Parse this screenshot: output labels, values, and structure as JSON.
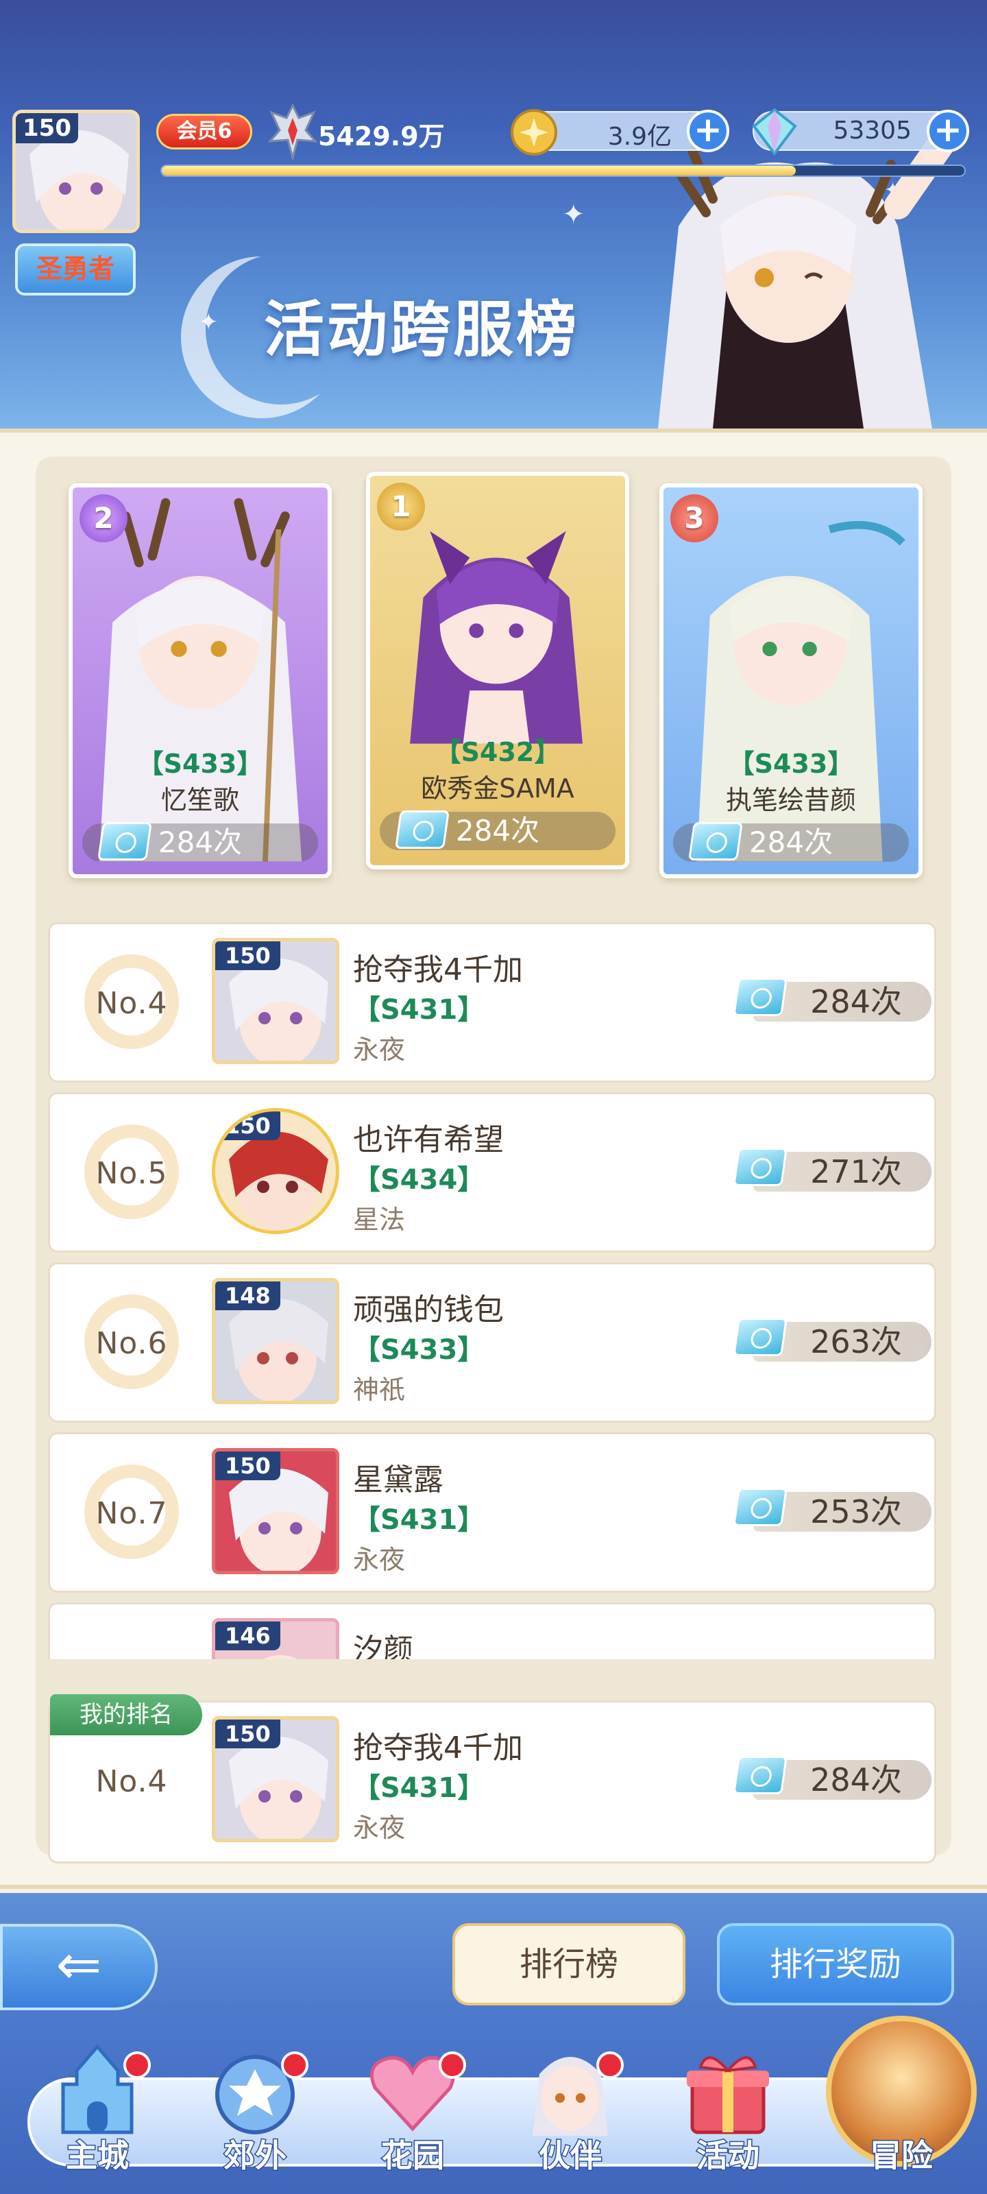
{
  "header": {
    "player_level": "150",
    "vip_label": "会员6",
    "power": "5429.9万",
    "gold_value": "3.9亿",
    "gem_value": "53305",
    "exp_progress": 0.79,
    "player_title": "圣勇者",
    "page_title": "活动跨服榜"
  },
  "podium": [
    {
      "rank": "2",
      "server": "【S433】",
      "name": "忆笙歌",
      "count": "284次"
    },
    {
      "rank": "1",
      "server": "【S432】",
      "name": "欧秀金SAMA",
      "count": "284次"
    },
    {
      "rank": "3",
      "server": "【S433】",
      "name": "执笔绘昔颜",
      "count": "284次"
    }
  ],
  "list": [
    {
      "rank": "No.4",
      "level": "150",
      "name": "抢夺我4千加",
      "server": "【S431】",
      "guild": "永夜",
      "count": "284次"
    },
    {
      "rank": "No.5",
      "level": "150",
      "name": "也许有希望",
      "server": "【S434】",
      "guild": "星法",
      "count": "271次"
    },
    {
      "rank": "No.6",
      "level": "148",
      "name": "顽强的钱包",
      "server": "【S433】",
      "guild": "神祇",
      "count": "263次"
    },
    {
      "rank": "No.7",
      "level": "150",
      "name": "星黛露",
      "server": "【S431】",
      "guild": "永夜",
      "count": "253次"
    },
    {
      "rank": "",
      "level": "146",
      "name": "汐颜",
      "server": "",
      "guild": "",
      "count": ""
    }
  ],
  "my_rank": {
    "label": "我的排名",
    "rank": "No.4",
    "level": "150",
    "name": "抢夺我4千加",
    "server": "【S431】",
    "guild": "永夜",
    "count": "284次"
  },
  "buttons": {
    "leaderboard": "排行榜",
    "rewards": "排行奖励"
  },
  "nav": [
    {
      "label": "主城",
      "icon": "castle-icon"
    },
    {
      "label": "郊外",
      "icon": "portal-icon"
    },
    {
      "label": "花园",
      "icon": "heart-garden-icon"
    },
    {
      "label": "伙伴",
      "icon": "partner-icon"
    },
    {
      "label": "活动",
      "icon": "gift-icon"
    },
    {
      "label": "冒险",
      "icon": "adventure-icon"
    }
  ],
  "colors": {
    "server_green": "#1d8a58",
    "header_blue": "#3f63b8",
    "accent_gold": "#f2c450"
  }
}
